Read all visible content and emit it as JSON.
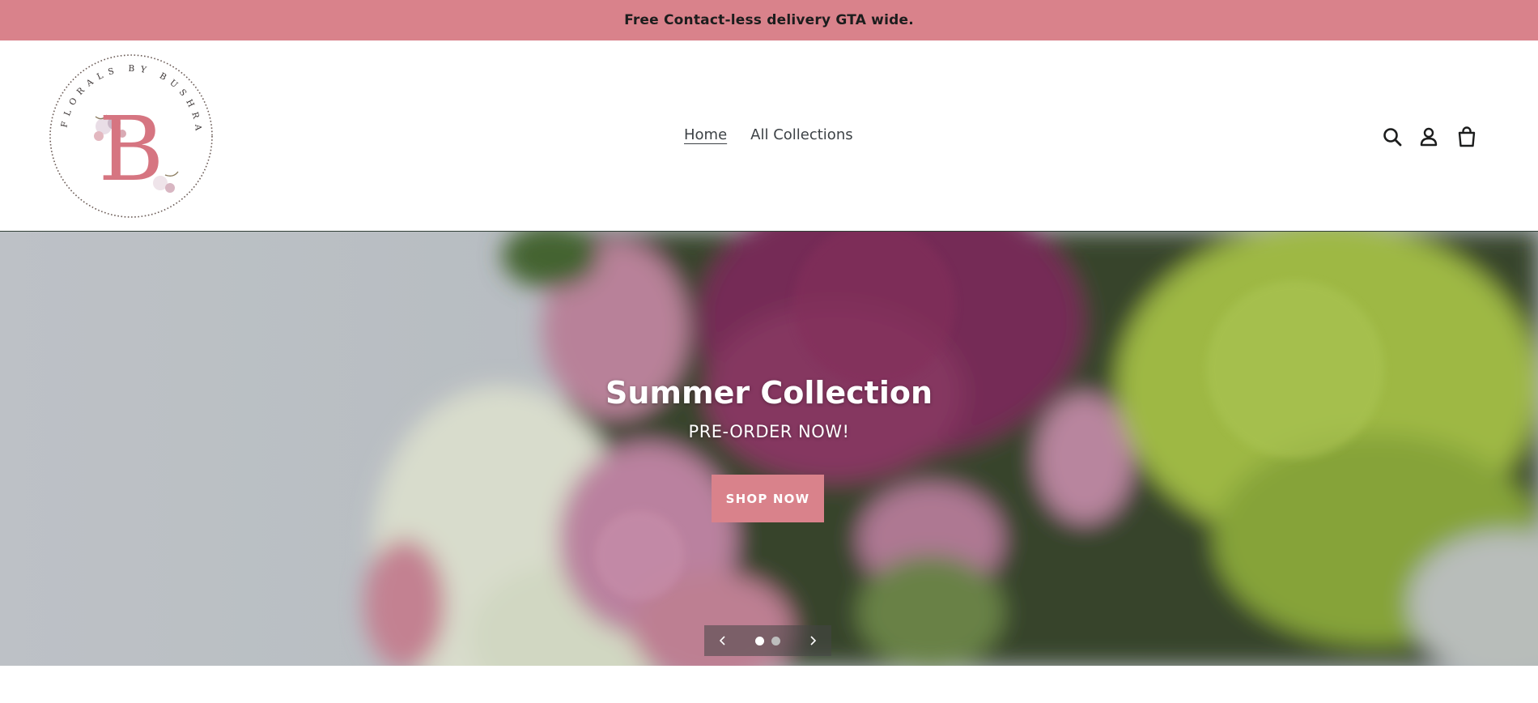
{
  "announcement": {
    "text": "Free Contact-less delivery GTA wide."
  },
  "brand": {
    "logo_letter": "B",
    "logo_ring_text": "FLORALS BY BUSHRA",
    "accent_color": "#d9828b"
  },
  "nav": {
    "items": [
      {
        "label": "Home",
        "active": true
      },
      {
        "label": "All Collections",
        "active": false
      }
    ]
  },
  "header_icons": {
    "search": "search-icon",
    "account": "account-icon",
    "cart": "cart-icon"
  },
  "hero": {
    "title": "Summer Collection",
    "subtitle": "PRE-ORDER NOW!",
    "button_label": "SHOP NOW",
    "slides_total": 2,
    "active_slide": 1,
    "prev_icon": "chevron-left-icon",
    "next_icon": "chevron-right-icon"
  }
}
